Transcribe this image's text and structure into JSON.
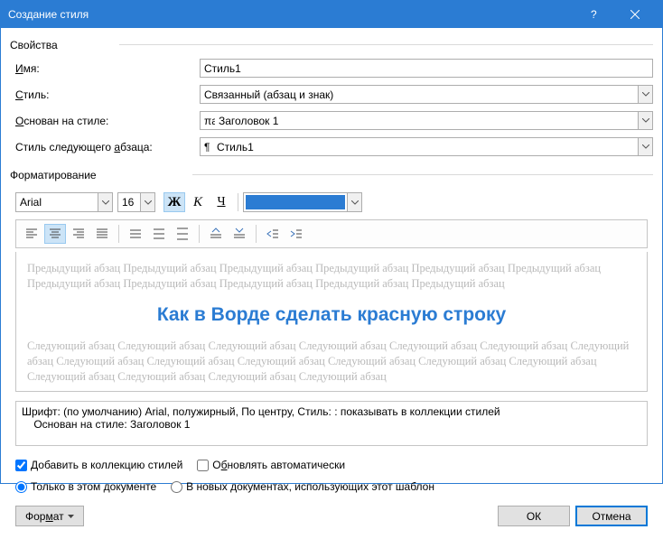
{
  "title": "Создание стиля",
  "properties_section": "Свойства",
  "labels": {
    "name_pre": "",
    "name_u": "И",
    "name_post": "мя:",
    "style_pre": "",
    "style_u": "С",
    "style_post": "тиль:",
    "based_pre": "",
    "based_u": "О",
    "based_post": "снован на стиле:",
    "next_pre": "Стиль следующего ",
    "next_u": "а",
    "next_post": "бзаца:"
  },
  "name_value": "Стиль1",
  "style_value": "Связанный (абзац и знак)",
  "based_value": "Заголовок 1",
  "next_value": "Стиль1",
  "formatting_section": "Форматирование",
  "font_name": "Arial",
  "font_size": "16",
  "bold_char": "Ж",
  "italic_char": "К",
  "underline_char": "Ч",
  "color_hex": "#2b7cd3",
  "preview_prev": "Предыдущий абзац Предыдущий абзац Предыдущий абзац Предыдущий абзац Предыдущий абзац Предыдущий абзац Предыдущий абзац Предыдущий абзац Предыдущий абзац Предыдущий абзац Предыдущий абзац",
  "preview_sample": "Как в Ворде сделать красную строку",
  "preview_next": "Следующий абзац Следующий абзац Следующий абзац Следующий абзац Следующий абзац Следующий абзац Следующий абзац Следующий абзац Следующий абзац Следующий абзац Следующий абзац Следующий абзац Следующий абзац Следующий абзац Следующий абзац Следующий абзац Следующий абзац",
  "description_line1": "Шрифт: (по умолчанию) Arial, полужирный, По центру, Стиль: : показывать в коллекции стилей",
  "description_line2": "    Основан на стиле: Заголовок 1",
  "add_to_gallery_pre": "",
  "add_to_gallery_u": "Д",
  "add_to_gallery_post": "обавить в коллекцию стилей",
  "auto_update_pre": "О",
  "auto_update_u": "б",
  "auto_update_post": "новлять автоматически",
  "only_doc": "Только в этом документе",
  "new_docs": "В новых документах, использующих этот шаблон",
  "format_btn_pre": "Фор",
  "format_btn_u": "м",
  "format_btn_post": "ат",
  "ok": "ОК",
  "cancel": "Отмена",
  "add_checked": true,
  "only_doc_checked": true
}
